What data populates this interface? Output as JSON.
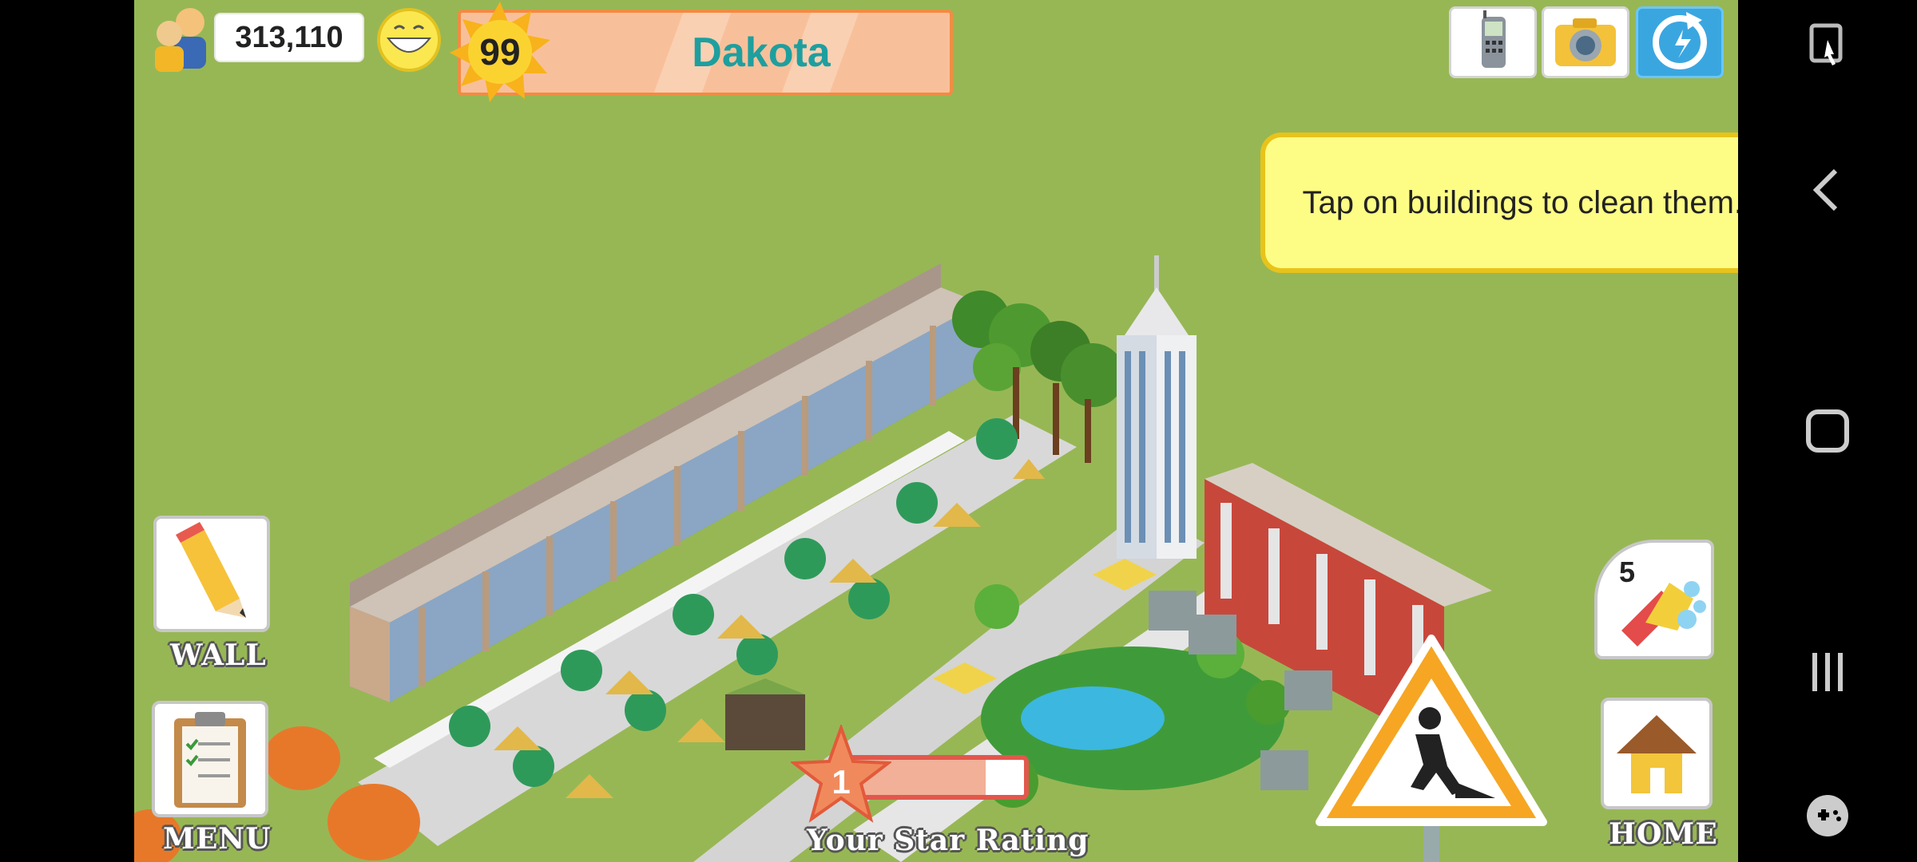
{
  "hud": {
    "population": "313,110",
    "level": "99",
    "player_name": "Dakota",
    "star_rating_value": "1",
    "star_rating_label": "Your Star Rating",
    "star_rating_progress": 0.8
  },
  "tooltip": {
    "text": "Tap on buildings to clean them."
  },
  "buttons": {
    "wall_label": "WALL",
    "menu_label": "MENU",
    "home_label": "HOME",
    "clean_count": "5"
  },
  "icons": {
    "population": "people-icon",
    "happiness": "smiley-icon",
    "level": "sun-badge-icon",
    "phone": "phone-icon",
    "camera": "camera-icon",
    "refresh": "refresh-icon",
    "wall": "pencil-icon",
    "menu": "clipboard-icon",
    "clean": "soap-sponge-icon",
    "home": "house-icon",
    "construction": "construction-sign-icon"
  },
  "colors": {
    "grass": "#97b755",
    "banner_fill": "#f8c09a",
    "banner_border": "#f18c42",
    "name_text": "#1e9f9f",
    "tooltip_fill": "#fdfc85",
    "tooltip_border": "#e8c31a"
  }
}
